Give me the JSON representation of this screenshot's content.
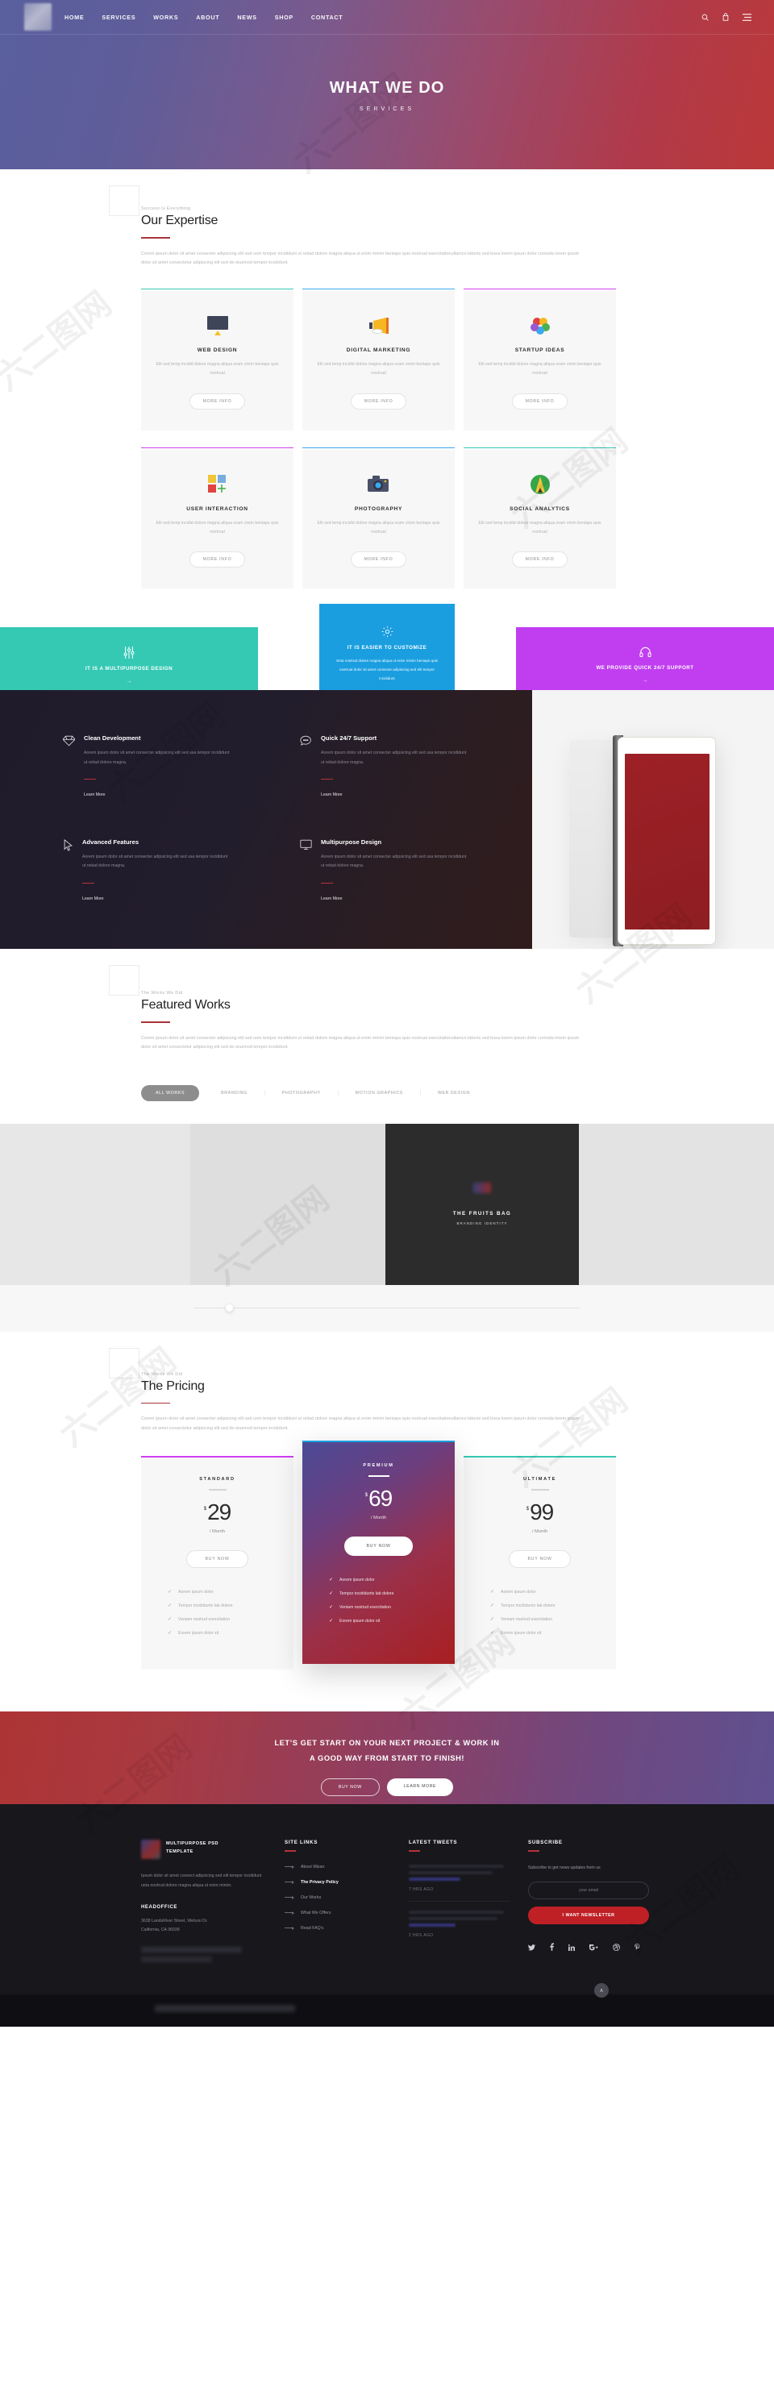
{
  "nav": {
    "links": [
      "HOME",
      "SERVICES",
      "WORKS",
      "ABOUT",
      "NEWS",
      "SHOP",
      "CONTACT"
    ],
    "icons": [
      "search-icon",
      "cart-icon",
      "menu-icon"
    ]
  },
  "hero": {
    "title": "WHAT WE DO",
    "subtitle": "SERVICES"
  },
  "expertise": {
    "eyebrow": "Success Is Everything",
    "title": "Our Expertise",
    "desc": "Corem ipsum dolor sit amet consecter adipiscing elit sed usm tempor incididunt ut reitad dolore magna aliqua ut enim minim beniaps quis nostrual exercitationullamco laboris sed boea lorem ipsum dolor comoda lorem ipsum dolor sit amet consectetur adipiscing elit sed do eiusmod tempor incididunt.",
    "cards": [
      {
        "title": "WEB DESIGN",
        "desc": "Elit sed temp incidid dolore magna aliqua oram cinim beniaps quis nostrual",
        "button": "MORE INFO",
        "bar_color": "#35c9b4",
        "icon": "monitor-icon"
      },
      {
        "title": "DIGITAL MARKETING",
        "desc": "Elit sed temp incidid dolore magna aliqua oram cinim beniaps quis nostrual",
        "button": "MORE INFO",
        "bar_color": "#3aa9ec",
        "icon": "megaphone-icon"
      },
      {
        "title": "STARTUP IDEAS",
        "desc": "Elit sed temp incidid dolore magna aliqua oram cinim beniaps quis nostrual",
        "button": "MORE INFO",
        "bar_color": "#d13ef0",
        "icon": "color-wheel-icon"
      },
      {
        "title": "USER INTERACTION",
        "desc": "Elit sed temp incidid dolore magna aliqua oram cinim beniaps quis nostrual",
        "button": "MORE INFO",
        "bar_color": "#d13ef0",
        "icon": "squares-plus-icon"
      },
      {
        "title": "PHOTOGRAPHY",
        "desc": "Elit sed temp incidid dolore magna aliqua oram cinim beniaps quis nostrual",
        "button": "MORE INFO",
        "bar_color": "#3aa9ec",
        "icon": "camera-icon"
      },
      {
        "title": "SOCIAL ANALYTICS",
        "desc": "Elit sed temp incidid dolore magna aliqua oram cinim beniaps quis nostrual",
        "button": "MORE INFO",
        "bar_color": "#35c9b4",
        "icon": "pencil-circle-icon"
      }
    ]
  },
  "tri_banner": {
    "left": {
      "label": "IT IS A MULTIPURPOSE DESIGN",
      "icon": "sliders-icon",
      "arrow": "→",
      "bg": "#35c9b4"
    },
    "center": {
      "label": "IT IS EASIER TO CUSTOMIZE",
      "icon": "gear-icon",
      "bg": "#1a9ee0",
      "desc": "Seta nostrud dolore magna aliqua ut enim minim beniaps quis nostrual dolor sit amet consecte adipiscing sed elit tempor incididunt"
    },
    "right": {
      "label": "WE PROVIDE QUICK 24/7 SUPPORT",
      "icon": "headphones-icon",
      "arrow": "→",
      "bg": "#c03ef0"
    }
  },
  "dark_features": [
    {
      "title": "Clean Development",
      "desc": "Aorem ipsum dolor sit amet consecter adipsicing elit sed usa tempor incididunt ut reitad dolore magna.",
      "link": "Learn More",
      "icon": "diamond-icon"
    },
    {
      "title": "Quick 24/7 Support",
      "desc": "Aorem ipsum dolor sit amet consecter adipsicing elit sed usa tempor incididunt ut reitad dolore magna.",
      "link": "Learn More",
      "icon": "chat-bubble-icon"
    },
    {
      "title": "Advanced Features",
      "desc": "Aorem ipsum dolor sit amet consecter adipsicing elit sed usa tempor incididunt ut reitad dolore magna.",
      "link": "Learn More",
      "icon": "cursor-icon"
    },
    {
      "title": "Multipurpose Design",
      "desc": "Aorem ipsum dolor sit amet consecter adipsicing elit sed usa tempor incididunt ut reitad dolore magna.",
      "link": "Learn More",
      "icon": "monitor-outline-icon"
    }
  ],
  "works": {
    "eyebrow": "The Works We Did",
    "title": "Featured Works",
    "desc": "Corem ipsum dolor sit amet consecter adipiscing elit sed usm tempor incididunt ut reitad dolore magna aliqua ut enim minim beniaps quis nostrual exercitationullamco laboris sed boea lorem ipsum dolor comoda lorem ipsum dolor sit amet consectetur adipiscing elit sed do eiusmod tempor incididunt.",
    "filters": [
      "ALL WORKS",
      "BRANDING",
      "PHOTOGRAPHY",
      "MOTION GRAPHICS",
      "WEB DESIGN"
    ],
    "active_filter": "ALL WORKS",
    "item": {
      "title": "THE FRUITS BAG",
      "category": "BRANDING IDENTITY"
    }
  },
  "pricing": {
    "eyebrow": "The Works We Did",
    "title": "The Pricing",
    "desc": "Corem ipsum dolor sit amet consecter adipiscing elit sed usm tempor incididunt ut reitad dolore magna aliqua ut enim minim beniaps quis nostrual exercitationullamco laboris sed boea lorem ipsum dolor comoda lorem ipsum dolor sit amet consectetur adipiscing elit sed do eiusmod tempor incididunt.",
    "plans": [
      {
        "name": "STANDARD",
        "currency": "$",
        "price": "29",
        "period": "/ Month",
        "button": "BUY NOW",
        "bar_color": "#d13ef0",
        "featured": false,
        "features": [
          "Aorem ipsum dolor",
          "Tempor incididunts lab dolore",
          "Veniam nostrud exercitation",
          "Eorem ipsum dolor sit"
        ]
      },
      {
        "name": "PREMIUM",
        "currency": "$",
        "price": "69",
        "period": "/ Month",
        "button": "BUY NOW",
        "bar_color": "#1a9ee0",
        "featured": true,
        "features": [
          "Aorem ipsum dolor",
          "Tempor incididunts lab dolore",
          "Veniam nostrud exercitation",
          "Eorem ipsum dolor sit"
        ]
      },
      {
        "name": "ULTIMATE",
        "currency": "$",
        "price": "99",
        "period": "/ Month",
        "button": "BUY NOW",
        "bar_color": "#35c9b4",
        "featured": false,
        "features": [
          "Aorem ipsum dolor",
          "Tempor incididunts lab dolore",
          "Veniam nostrud exercitation",
          "Eorem ipsum dolor sit"
        ]
      }
    ]
  },
  "cta": {
    "line1": "LET’S GET START ON YOUR NEXT PROJECT & WORK IN",
    "line2": "A GOOD WAY FROM START TO FINISH!",
    "btn_ghost": "BUY NOW",
    "btn_solid": "LEARN MORE"
  },
  "footer": {
    "brand": {
      "line1": "MULTIPURPOSE PSD",
      "line2": "TEMPLATE",
      "desc": "Ipsum dolor sit amet consect adipsicing sed elit tempor incididunt ueta nostrud dolore magna aliqua ut enim minim.",
      "office_heading": "HEADOFFICE",
      "address1": "3638 LandsRiver Street, Welson Dr.",
      "address2": "California, CA 36038"
    },
    "site_links": {
      "heading": "SITE LINKS",
      "items": [
        {
          "label": "About Mizan",
          "bold": false
        },
        {
          "label": "The Privacy Policy",
          "bold": true
        },
        {
          "label": "Our Works",
          "bold": false
        },
        {
          "label": "What We Offers",
          "bold": false
        },
        {
          "label": "Read FAQ’s",
          "bold": false
        }
      ]
    },
    "tweets": {
      "heading": "LATEST TWEETS",
      "items": [
        {
          "time": "7 HRS AGO"
        },
        {
          "time": "2 HRS AGO"
        }
      ]
    },
    "subscribe": {
      "heading": "SUBSCRIBE",
      "desc": "Subscribe to get news updates from us",
      "placeholder": "your email",
      "button": "I WANT NEWSLETTER",
      "button_color": "#bf2026",
      "socials": [
        "twitter-icon",
        "facebook-icon",
        "linkedin-icon",
        "google-plus-icon",
        "dribbble-icon",
        "pinterest-icon"
      ]
    },
    "to_top": "∧"
  }
}
